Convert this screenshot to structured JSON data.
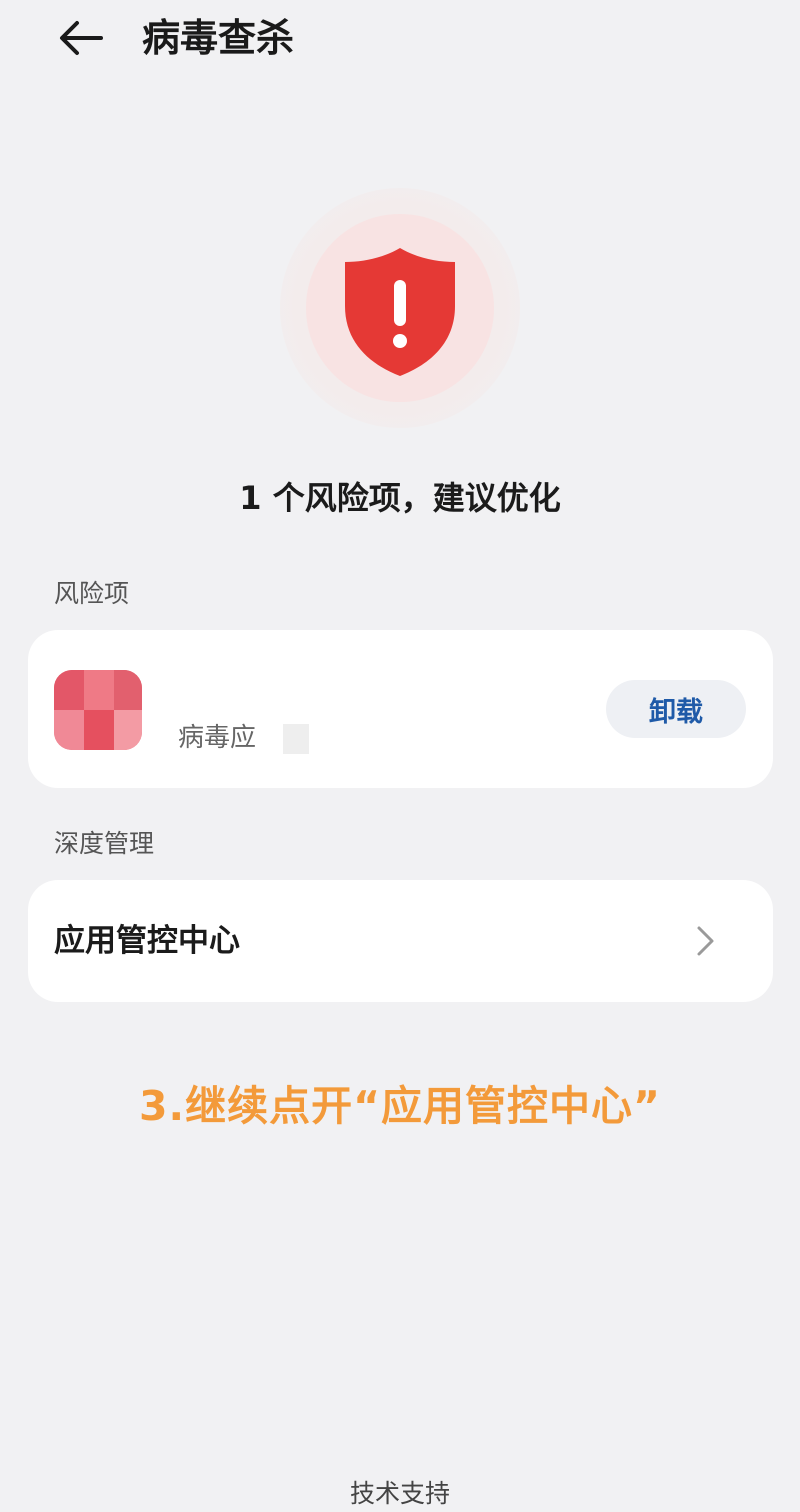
{
  "header": {
    "title": "病毒查杀",
    "back_icon": "arrow-left-icon"
  },
  "status": {
    "icon": "shield-alert-icon",
    "text": "1 个风险项，建议优化",
    "accent_color": "#e53935"
  },
  "risk_section": {
    "label": "风险项",
    "items": [
      {
        "app_name": "",
        "sub": "病毒应",
        "action_label": "卸载"
      }
    ]
  },
  "deep_section": {
    "label": "深度管理",
    "items": [
      {
        "label": "应用管控中心",
        "icon": "chevron-right-icon"
      }
    ]
  },
  "caption": "3.继续点开“应用管控中心”",
  "footer": {
    "link": "技术支持"
  }
}
